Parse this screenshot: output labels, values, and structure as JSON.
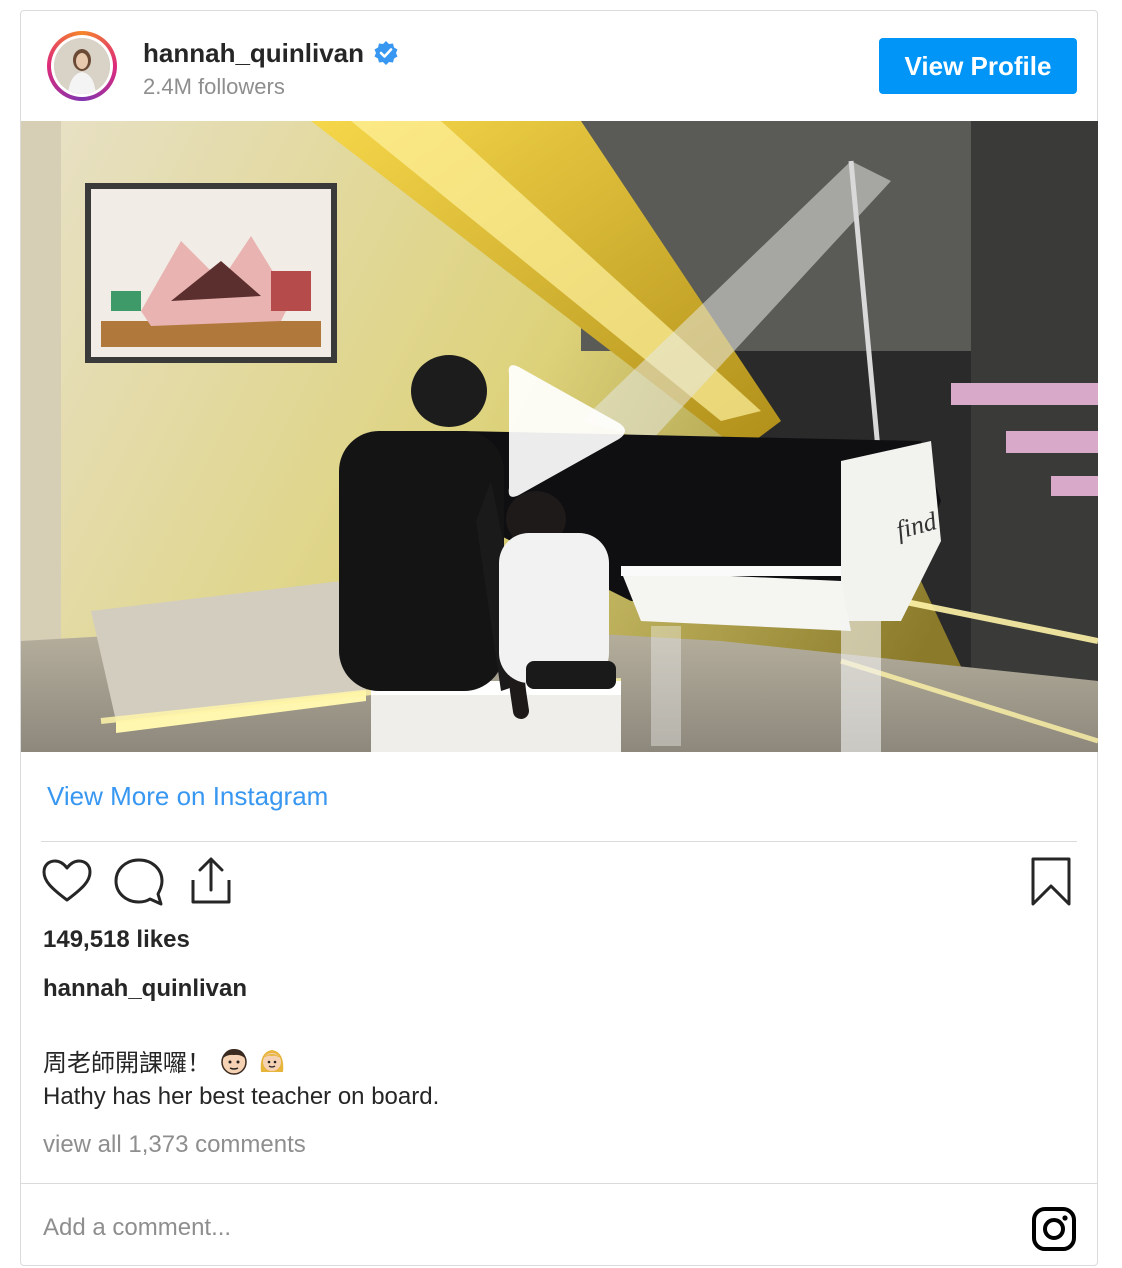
{
  "header": {
    "username": "hannah_quinlivan",
    "followers": "2.4M followers",
    "view_profile_label": "View Profile"
  },
  "media": {
    "play_icon": "play-icon",
    "piano_text": "find"
  },
  "view_more_label": "View More on Instagram",
  "actions": {
    "like_icon": "heart-icon",
    "comment_icon": "comment-icon",
    "share_icon": "share-icon",
    "save_icon": "bookmark-icon"
  },
  "post": {
    "likes": "149,518 likes",
    "caption_user": "hannah_quinlivan",
    "caption_line1": "周老師開課囉！",
    "caption_emojis": [
      "man-face-emoji",
      "blond-girl-emoji"
    ],
    "caption_line2": "Hathy has her best teacher on board.",
    "view_all_comments": "view all 1,373 comments"
  },
  "comment": {
    "placeholder": "Add a comment..."
  },
  "colors": {
    "accent_blue": "#0095f6",
    "link_blue": "#3897f0",
    "muted_gray": "#8e8e8e",
    "text_dark": "#262626"
  }
}
